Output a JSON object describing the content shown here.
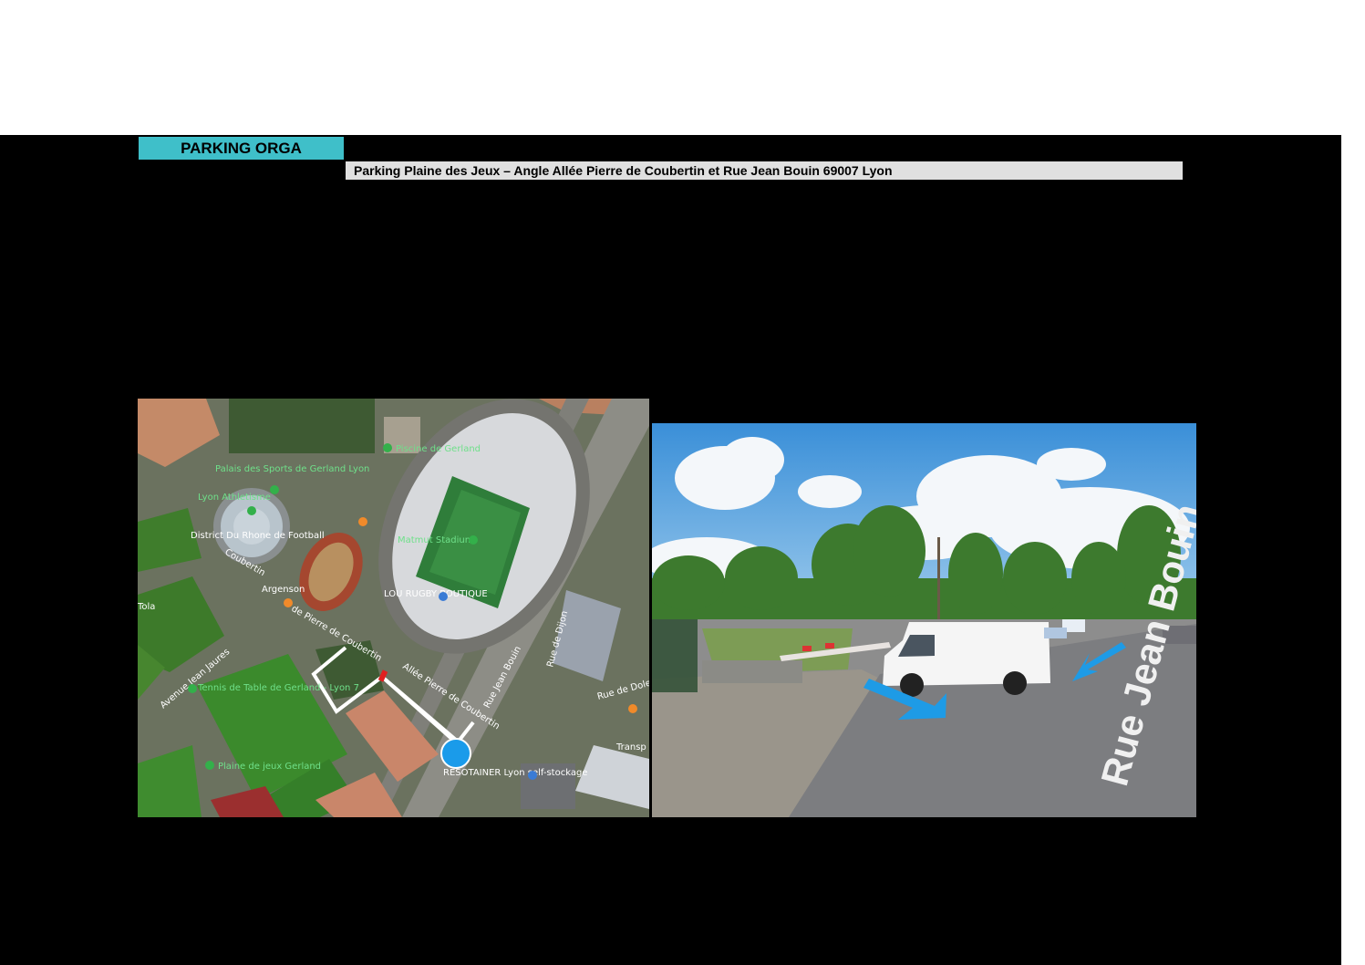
{
  "header": {
    "title": "PARKING ORGA",
    "address": "Parking Plaine des Jeux – Angle Allée Pierre de Coubertin et Rue Jean Bouin 69007 Lyon"
  },
  "map": {
    "labels": {
      "piscine": "Piscine de Gerland",
      "palais": "Palais des Sports de Gerland Lyon",
      "athletisme": "Lyon Athletisme",
      "district": "District Du Rhone de Football",
      "matmut": "Matmut Stadium",
      "lou": "LOU RUGBY BOUTIQUE",
      "argenson": "Argenson",
      "tennis": "Tennis de Table de Gerland - Lyon 7",
      "plaine": "Plaine de jeux Gerland",
      "resotainer": "RESOTAINER Lyon self-stockage",
      "coubertin_av": "Allée Pierre de Coubertin",
      "pierre_coub": "de Pierre de Coubertin",
      "jean_bouin": "Rue Jean Bouin",
      "dijon": "Rue de Dijon",
      "dole": "Rue de Dole",
      "jean_jaures": "Avenue Jean Jaures",
      "coubertin": "Coubertin",
      "tola": "Tola",
      "transp": "Transp"
    },
    "route_color": "#ffffff",
    "marker_color": "#1a9bea"
  },
  "photo": {
    "street_label": "Rue Jean Bouin",
    "arrow_color": "#1e9be6"
  }
}
